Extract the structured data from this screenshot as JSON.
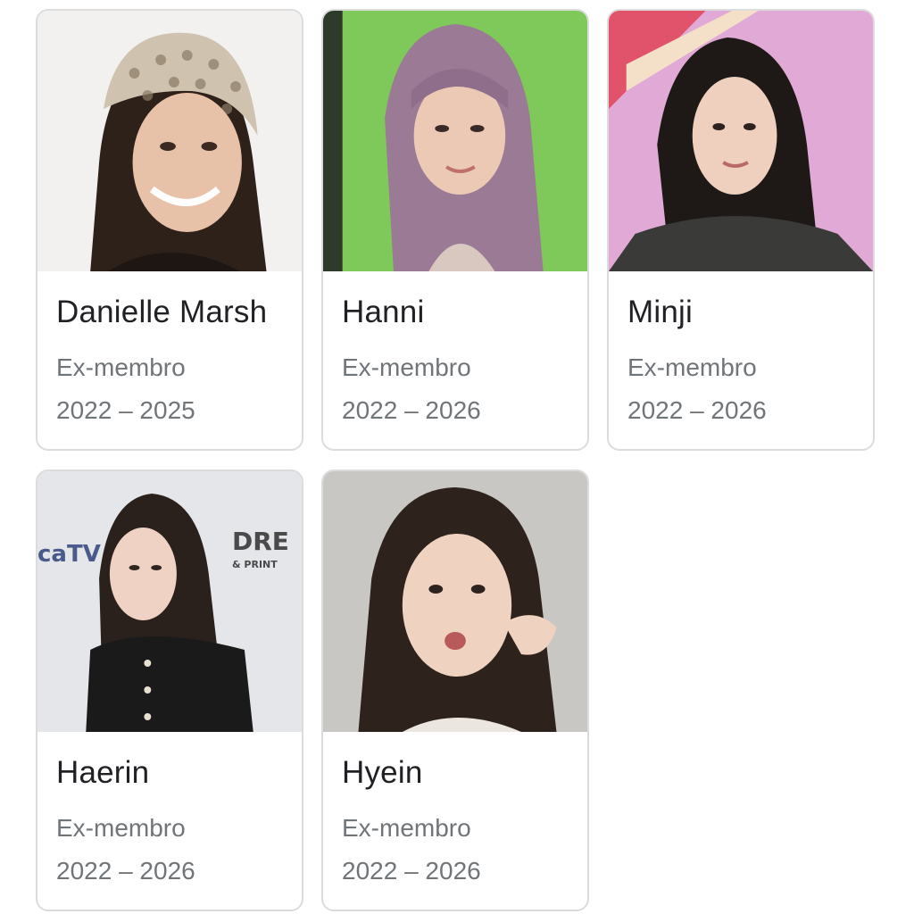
{
  "members": [
    {
      "name": "Danielle Marsh",
      "status": "Ex-membro",
      "years": "2022 – 2025"
    },
    {
      "name": "Hanni",
      "status": "Ex-membro",
      "years": "2022 – 2026"
    },
    {
      "name": "Minji",
      "status": "Ex-membro",
      "years": "2022 – 2026"
    },
    {
      "name": "Haerin",
      "status": "Ex-membro",
      "years": "2022 – 2026"
    },
    {
      "name": "Hyein",
      "status": "Ex-membro",
      "years": "2022 – 2026"
    }
  ],
  "photo_signage": {
    "left_logo": "caTV",
    "right_logo": "DRE",
    "right_logo_sub": "& PRINT"
  },
  "colors": {
    "card_border": "#dcdcdc",
    "name_text": "#202124",
    "secondary_text": "#70757a"
  }
}
